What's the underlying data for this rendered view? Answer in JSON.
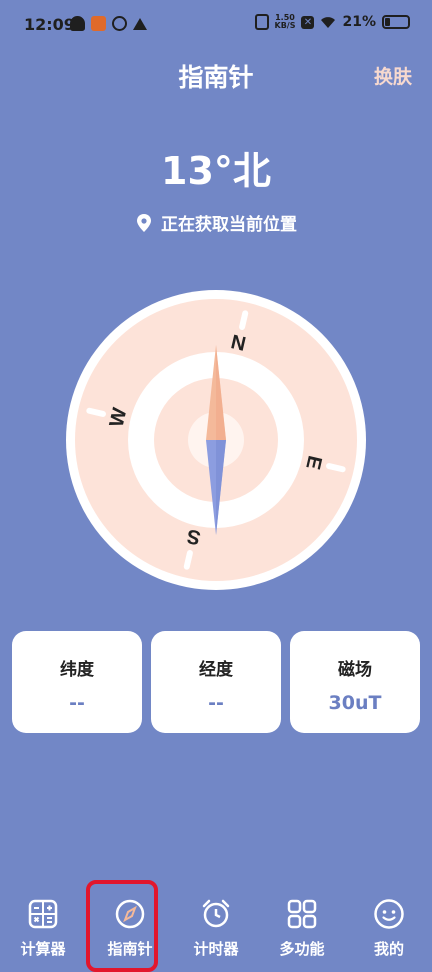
{
  "status_bar": {
    "time": "12:09",
    "net_speed_value": "1.50",
    "net_speed_unit": "KB/S",
    "battery_pct": "21%",
    "battery_level": 0.21
  },
  "header": {
    "title": "指南针",
    "skin_label": "换肤"
  },
  "heading": {
    "text": "13°北"
  },
  "location": {
    "text": "正在获取当前位置",
    "icon": "location-pin-icon"
  },
  "compass": {
    "cardinals": [
      "N",
      "E",
      "S",
      "W"
    ],
    "heading_degrees": 13,
    "ring_color": "#fde3d9",
    "north_needle_color": "#f4b99a",
    "south_needle_color": "#8c9de0"
  },
  "cards": [
    {
      "label": "纬度",
      "value": "--"
    },
    {
      "label": "经度",
      "value": "--"
    },
    {
      "label": "磁场",
      "value": "30uT"
    }
  ],
  "tabbar": {
    "active_index": 1,
    "highlight_color": "#e2162c",
    "items": [
      {
        "label": "计算器",
        "icon": "calculator-icon"
      },
      {
        "label": "指南针",
        "icon": "compass-icon"
      },
      {
        "label": "计时器",
        "icon": "alarm-clock-icon"
      },
      {
        "label": "多功能",
        "icon": "grid-icon"
      },
      {
        "label": "我的",
        "icon": "smiley-icon"
      }
    ]
  }
}
